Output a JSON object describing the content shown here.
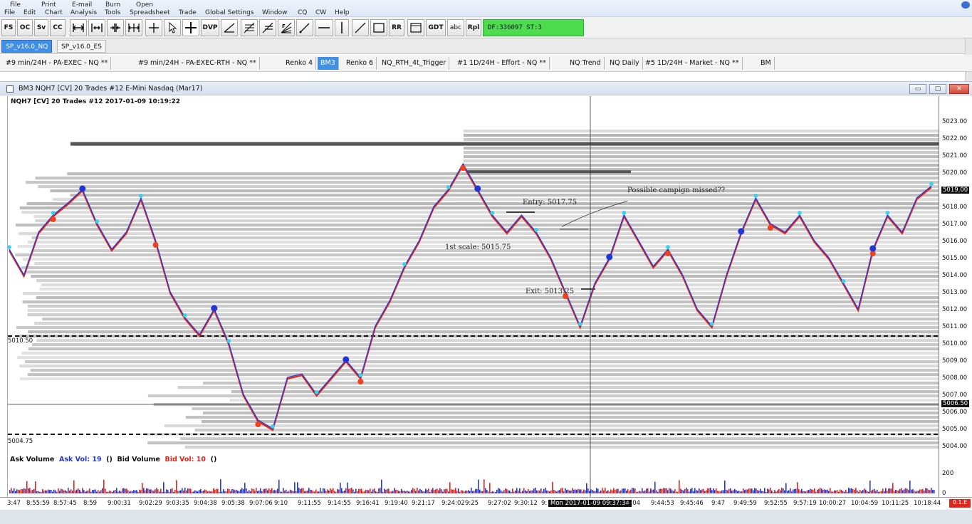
{
  "menu": {
    "row1": [
      "File",
      "Print",
      "E-mail",
      "Burn",
      "Open"
    ],
    "row2": [
      "File",
      "Edit",
      "Chart",
      "Analysis",
      "Tools",
      "Spreadsheet",
      "Trade",
      "Global Settings",
      "Window",
      "CQ",
      "CW",
      "Help"
    ]
  },
  "toolbar": {
    "fs": "FS",
    "oc": "OC",
    "sv": "Sv",
    "cc": "CC",
    "dvp": "DVP",
    "rr": "RR",
    "gdt": "GDT",
    "abc": "abc",
    "rpl": "Rpl",
    "status": "DF:336097 ST:3"
  },
  "workspaces": [
    "SP_v16.0_NQ",
    "SP_v16.0_ES"
  ],
  "chart_tabs": [
    "#9  min/24H  - PA-EXEC -  NQ    **",
    "#9  min/24H  - PA-EXEC-RTH -  NQ    **",
    "Renko 4",
    "BM3",
    "Renko 6",
    "NQ_RTH_4t_Trigger",
    "#1  1D/24H  - Effort -  NQ    **",
    "NQ Trend",
    "NQ Daily",
    "#5  1D/24H  - Market -  NQ    **",
    "BM"
  ],
  "window": {
    "title": "BM3  NQH7 [CV]  20 Trades  #12  E-Mini Nasdaq (Mar17)",
    "min": "▭",
    "max": "▢",
    "close": "✕"
  },
  "chart": {
    "header": "NQH7 [CV]  20 Trades  #12 2017-01-09 10:19:22",
    "level_upper_label": "5010.50",
    "level_lower_label": "5004.75",
    "annotations": {
      "entry": "Entry: 5017.75",
      "first_scale": "1st scale: 5015.75",
      "exit": "Exit: 5013.25",
      "note": "Possible campign missed??"
    },
    "volume_legend": {
      "ask_label": "Ask Volume",
      "ask_vol": "Ask Vol: 19",
      "paren1": "()",
      "bid_label": "Bid Volume",
      "bid_vol": "Bid Vol: 10",
      "paren2": "()"
    },
    "volume_axis_label": "200",
    "volume_axis_zero": "0",
    "corner_box": "0.1.E"
  },
  "chart_data": {
    "type": "line",
    "title": "",
    "y_ticks": [
      "5023.00",
      "5022.00",
      "5021.00",
      "5020.00",
      "5019.00",
      "5018.00",
      "5017.00",
      "5016.00",
      "5015.00",
      "5014.00",
      "5013.00",
      "5012.00",
      "5011.00",
      "5010.00",
      "5009.00",
      "5008.00",
      "5007.00",
      "5006.50",
      "5006.00",
      "5005.00",
      "5004.00"
    ],
    "highlighted_prices": [
      "5019.00",
      "5006.50"
    ],
    "x_ticks": [
      "3:47",
      "8:55:59",
      "8:57:45",
      "8:59",
      "9:00:31",
      "9:02:29",
      "9:03:35",
      "9:04:38",
      "9:05:38",
      "9:07:06",
      "9:10",
      "9:11:55",
      "9:14:55",
      "9:16:41",
      "9:19:40",
      "9:21:17",
      "9:24:02",
      "9:25",
      "9:27:02",
      "9:30:12",
      "9:",
      "Mon 2017-01-09  09:37:34",
      "1:04",
      "9:44:53",
      "9:45:46",
      "9:47",
      "9:49:59",
      "9:52:55",
      "9:57:19",
      "10:00:27",
      "10:04:59",
      "10:11:25",
      "10:18:44"
    ],
    "ylim": [
      5003.5,
      5023.5
    ],
    "series": [
      {
        "values": [
          5015.5,
          5014.0,
          5016.5,
          5017.5,
          5018.2,
          5019.0,
          5017.0,
          5015.5,
          5016.5,
          5018.5,
          5016.0,
          5013.0,
          5011.5,
          5010.5,
          5012.0,
          5010.0,
          5007.0,
          5005.5,
          5005.0,
          5008.0,
          5008.2,
          5007.0,
          5008.0,
          5009.0,
          5008.0,
          5011.0,
          5012.5,
          5014.5,
          5016.0,
          5018.0,
          5019.0,
          5020.5,
          5019.0,
          5017.5,
          5016.5,
          5017.5,
          5016.5,
          5015.0,
          5013.0,
          5011.0,
          5013.5,
          5015.0,
          5017.5,
          5016.0,
          5014.5,
          5015.5,
          5014.0,
          5012.0,
          5011.0,
          5014.0,
          5016.5,
          5018.5,
          5017.0,
          5016.5,
          5017.5,
          5016.0,
          5015.0,
          5013.5,
          5012.0,
          5015.5,
          5017.5,
          5016.5,
          5018.5,
          5019.2
        ]
      }
    ]
  }
}
